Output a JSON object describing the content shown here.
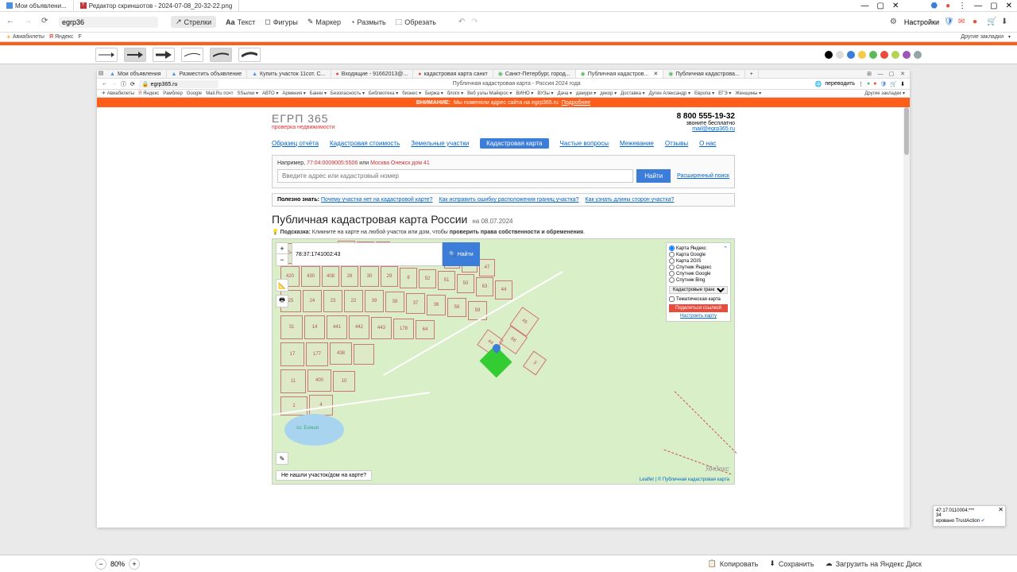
{
  "outer": {
    "tabs": [
      {
        "icon": "#4a90e2",
        "label": "Мои объявлени..."
      },
      {
        "icon": "#c33",
        "label": "Редактор скриншотов - 2024-07-08_20-32-22.png"
      }
    ],
    "addr": "egrp36",
    "tools": [
      {
        "icon": "arrow",
        "label": "Стрелки",
        "active": true
      },
      {
        "icon": "Aa",
        "label": "Текст"
      },
      {
        "icon": "shape",
        "label": "Фигуры"
      },
      {
        "icon": "marker",
        "label": "Маркер"
      },
      {
        "icon": "blur",
        "label": "Размыть"
      },
      {
        "icon": "crop",
        "label": "Обрезать"
      }
    ],
    "settings": "Настройки",
    "bookmarks": [
      "Авиабилеты",
      "Яндекс",
      "F"
    ],
    "other_bookmarks": "Другие закладки"
  },
  "arrow_colors": [
    "#000",
    "#ddd",
    "#3b7dd8",
    "#f7c948",
    "#5cb85c",
    "#e74c3c",
    "#9b59b6",
    "#9b9b59",
    "#95a5a6"
  ],
  "inner": {
    "tabs": [
      {
        "label": "Мои объявления"
      },
      {
        "label": "Разместить объявление"
      },
      {
        "label": "Купить участок 11сот. С..."
      },
      {
        "label": "Входящие - 91662013@..."
      },
      {
        "label": "кадастровая карта санкт"
      },
      {
        "label": "Санкт-Петербург, город..."
      },
      {
        "label": "Публичная кадастров...",
        "active": true
      },
      {
        "label": "Публичная кадастрова..."
      }
    ],
    "url": "egrp365.ru",
    "page_title": "Публичная кадастровая карта - Россия 2024 года",
    "translate": "переводить",
    "bookmarks": [
      "Авиабилеты",
      "Яндекс",
      "Рамблер",
      "Google",
      "Mail.Ru почт",
      "SSылки ▾",
      "АВТО ▾",
      "Армения ▾",
      "Банки ▾",
      "Безопасность ▾",
      "Библиотека ▾",
      "бизнес ▾",
      "Биржа ▾",
      "блоги ▾",
      "Веб узлы Майкрос ▾",
      "ВИНО ▾",
      "ВУЗы ▾",
      "Дача ▾",
      "дамури ▾",
      "декор ▾",
      "Доставка ▾",
      "Дугин Александр ▾",
      "Европа ▾",
      "ЕГЭ ▾",
      "Женщины ▾"
    ],
    "other_bookmarks": "Другие закладки ▾",
    "warn": {
      "prefix": "ВНИМАНИЕ:",
      "text": "Мы поменяли адрес сайта на egrp365.ru",
      "link": "Подробнее"
    }
  },
  "site": {
    "logo": "ЕГРП 365",
    "logo_sub": "проверка недвижимости",
    "phone": "8 800 555-19-32",
    "phone_sub": "звоните бесплатно",
    "email": "mail@egrp365.ru",
    "nav": [
      "Образец отчёта",
      "Кадастровая стоимость",
      "Земельные участки",
      "Кадастровая карта",
      "Частые вопросы",
      "Межевание",
      "Отзывы",
      "О нас"
    ],
    "nav_active": 3,
    "example": {
      "p": "Например,",
      "c1": "77:04:0009005:5506",
      "or": "или",
      "c2": "Москва Онежск дом 41"
    },
    "search_ph": "Введите адрес или кадастровый номер",
    "find": "Найти",
    "adv": "Расширенный поиск",
    "useful": {
      "label": "Полезно знать:",
      "links": [
        "Почему участка нет на кадастровой карте?",
        "Как исправить ошибку расположения границ участка?",
        "Как узнать длины сторон участка?"
      ]
    },
    "h1": "Публичная кадастровая карта России",
    "h1_date": "на 08.07.2024",
    "hint_icon": "💡",
    "hint_label": "Подсказка:",
    "hint_text": "Кликните на карте на любой участок или дом, чтобы",
    "hint_bold": "проверить права собственности и обременения",
    "map": {
      "search_value": "78:37:1741002:43",
      "find": "Найти",
      "layers": [
        "Карта Яндекс",
        "Карта Google",
        "Карта 2GIS",
        "Спутник Яндекс",
        "Спутник Google",
        "Спутник Bing"
      ],
      "layers_sel": 0,
      "boundaries": "Кадастровые границы ▾",
      "thematic": "Тематическая карта",
      "share": "Поделиться ссылкой",
      "tune": "Настроить карту",
      "lake": "оз. Ениши",
      "notfound": "Не нашли участок/дом на карте?",
      "leaflet": "Leaflet | © Публичная кадастровая карта",
      "ymaps": "Яндекс"
    }
  },
  "bottom": {
    "zoom": "80%",
    "copy": "Копировать",
    "save": "Сохранить",
    "upload": "Загрузить на Яндекс Диск"
  },
  "float": {
    "line1": "47:17:0110004:***",
    "line2": "34",
    "line3": "ировано TrustAction"
  }
}
